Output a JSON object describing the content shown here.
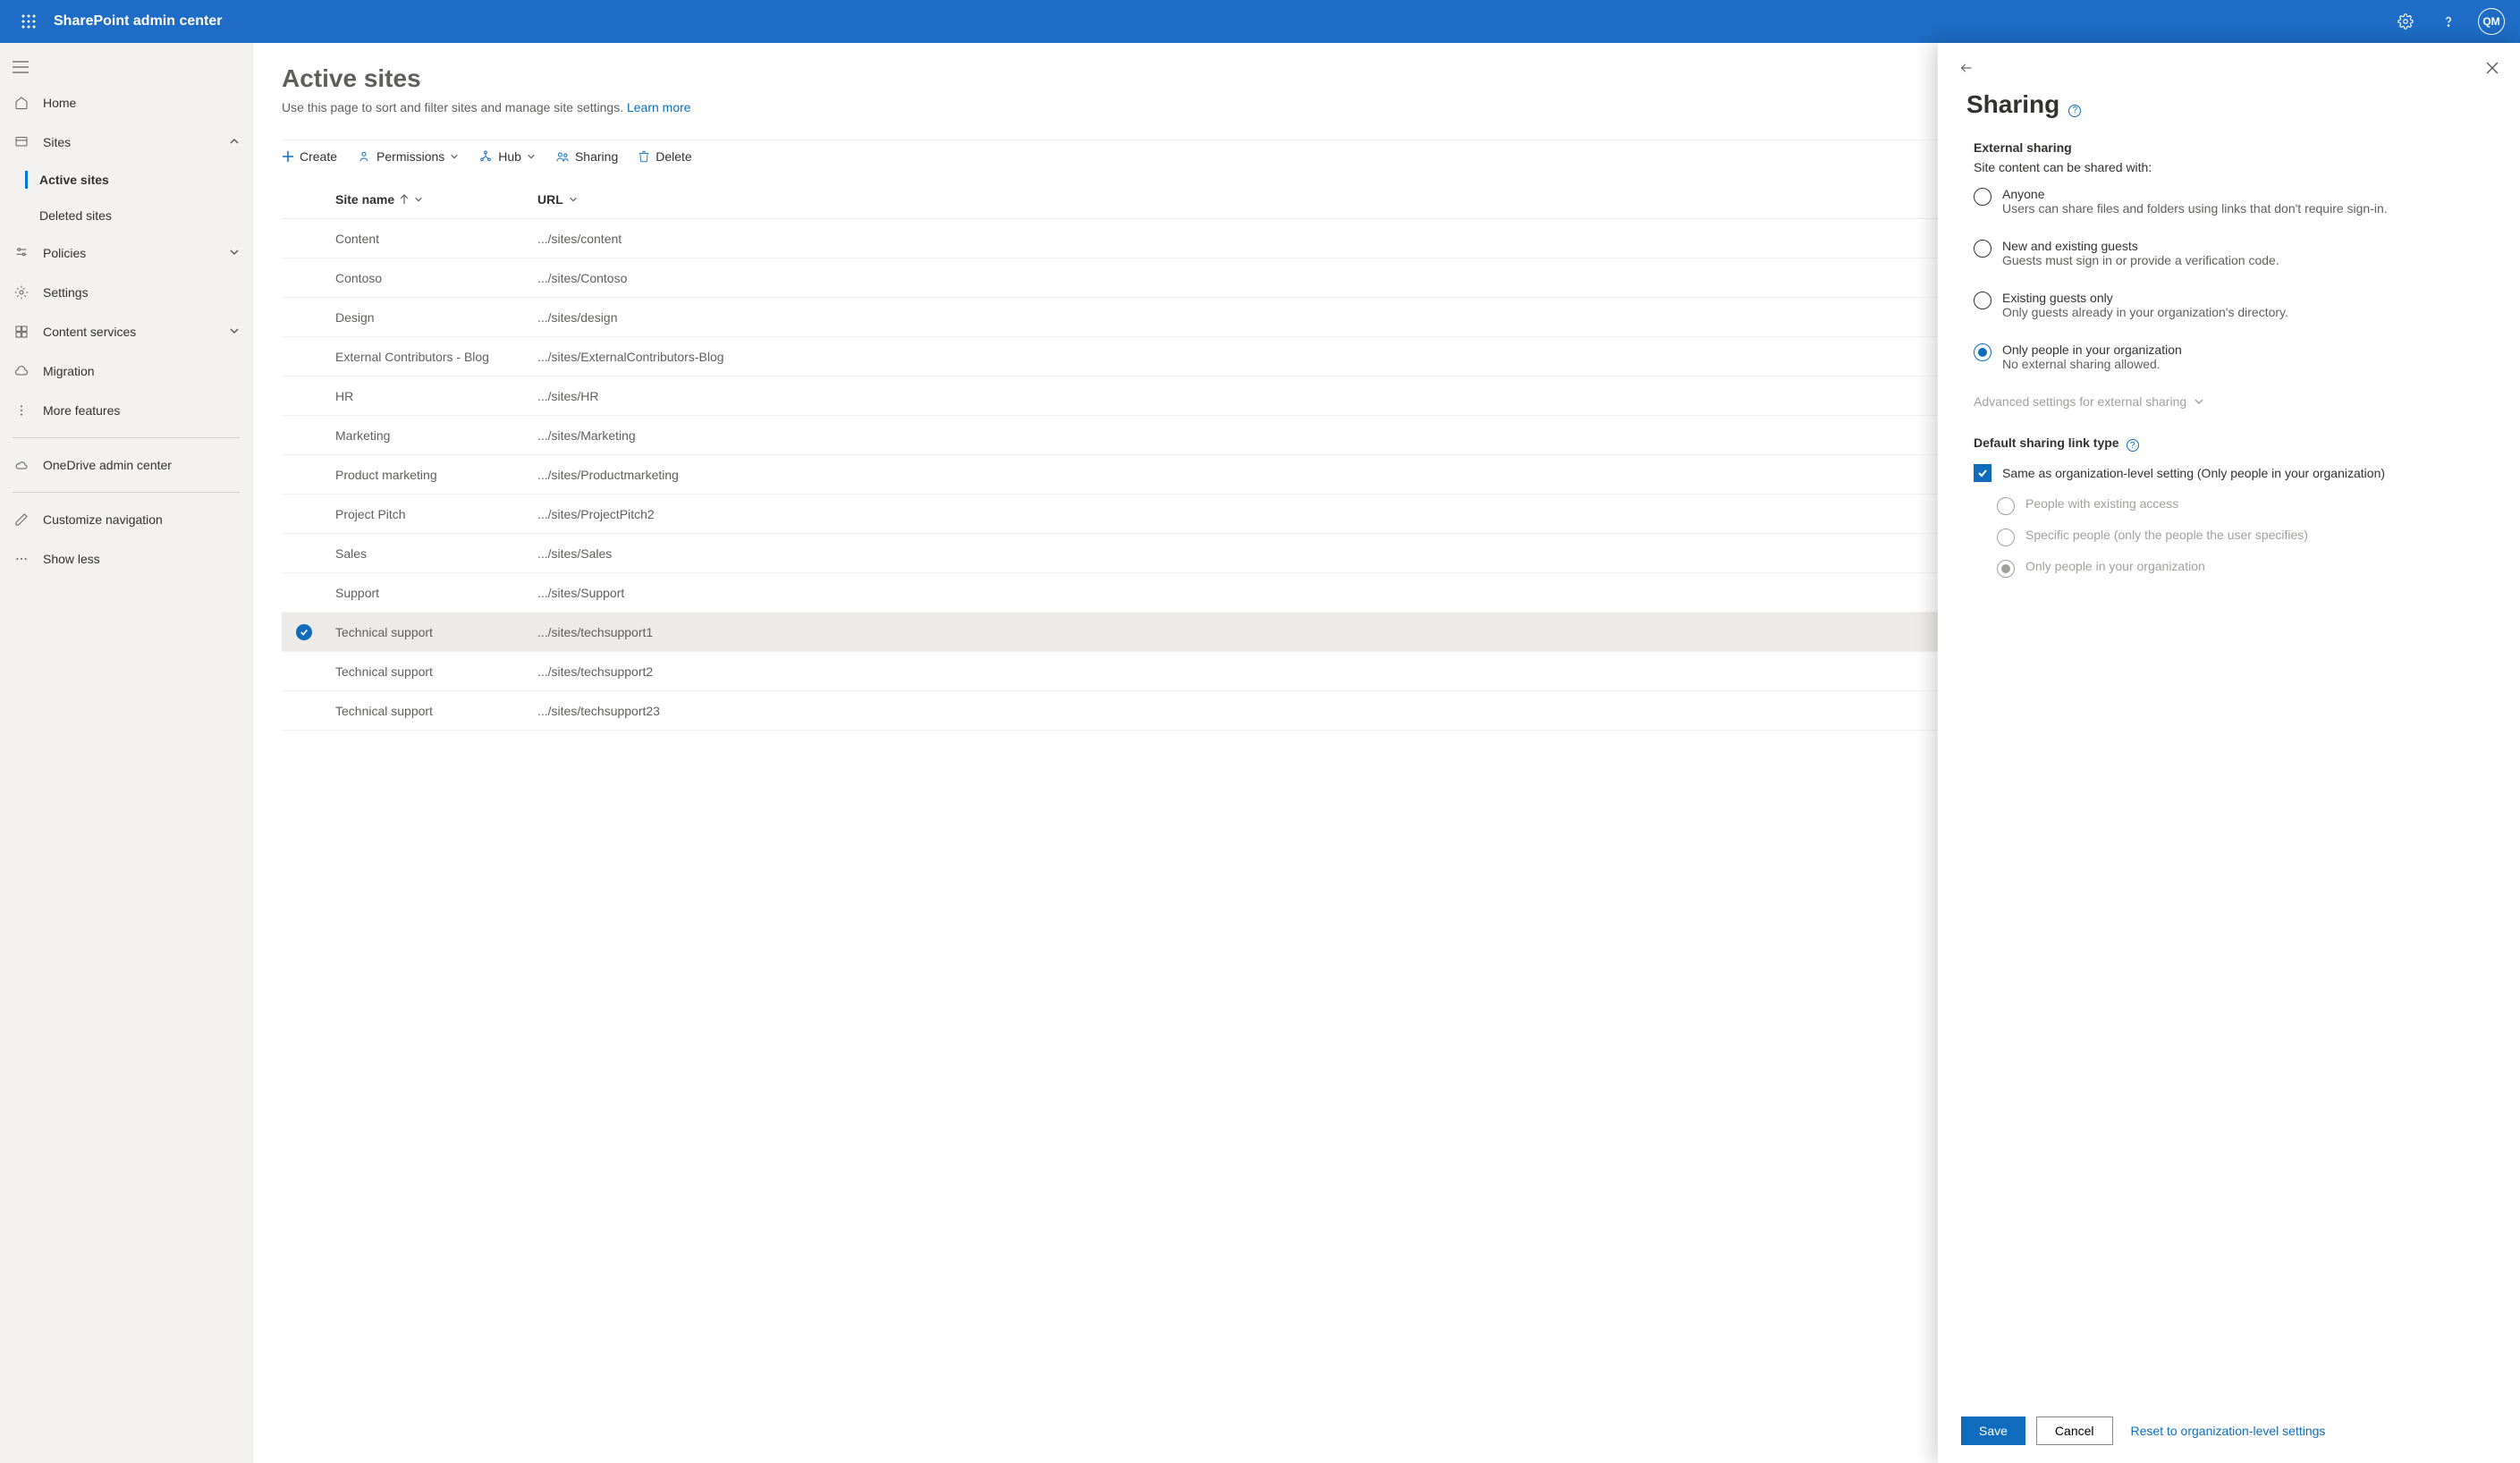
{
  "header": {
    "title": "SharePoint admin center",
    "avatar": "QM"
  },
  "sidebar": {
    "home": "Home",
    "sites": "Sites",
    "active_sites": "Active sites",
    "deleted_sites": "Deleted sites",
    "policies": "Policies",
    "settings": "Settings",
    "content_services": "Content services",
    "migration": "Migration",
    "more_features": "More features",
    "onedrive": "OneDrive admin center",
    "customize": "Customize navigation",
    "show_less": "Show less"
  },
  "page": {
    "title": "Active sites",
    "desc": "Use this page to sort and filter sites and manage site settings. ",
    "learn": "Learn more"
  },
  "cmdbar": {
    "create": "Create",
    "permissions": "Permissions",
    "hub": "Hub",
    "sharing": "Sharing",
    "delete": "Delete"
  },
  "table": {
    "col_name": "Site name",
    "col_url": "URL",
    "rows": [
      {
        "name": "Content",
        "url": ".../sites/content"
      },
      {
        "name": "Contoso",
        "url": ".../sites/Contoso"
      },
      {
        "name": "Design",
        "url": ".../sites/design"
      },
      {
        "name": "External Contributors - Blog",
        "url": ".../sites/ExternalContributors-Blog"
      },
      {
        "name": "HR",
        "url": ".../sites/HR"
      },
      {
        "name": "Marketing",
        "url": ".../sites/Marketing"
      },
      {
        "name": "Product marketing",
        "url": ".../sites/Productmarketing"
      },
      {
        "name": "Project Pitch",
        "url": ".../sites/ProjectPitch2"
      },
      {
        "name": "Sales",
        "url": ".../sites/Sales"
      },
      {
        "name": "Support",
        "url": ".../sites/Support"
      },
      {
        "name": "Technical support",
        "url": ".../sites/techsupport1",
        "selected": true
      },
      {
        "name": "Technical support",
        "url": ".../sites/techsupport2"
      },
      {
        "name": "Technical support",
        "url": ".../sites/techsupport23"
      }
    ]
  },
  "panel": {
    "title": "Sharing",
    "ext_title": "External sharing",
    "ext_desc": "Site content can be shared with:",
    "opts": [
      {
        "label": "Anyone",
        "sub": "Users can share files and folders using links that don't require sign-in."
      },
      {
        "label": "New and existing guests",
        "sub": "Guests must sign in or provide a verification code."
      },
      {
        "label": "Existing guests only",
        "sub": "Only guests already in your organization's directory."
      },
      {
        "label": "Only people in your organization",
        "sub": "No external sharing allowed.",
        "checked": true
      }
    ],
    "advanced": "Advanced settings for external sharing",
    "link_title": "Default sharing link type",
    "same_label": "Same as organization-level setting (Only people in your organization)",
    "link_opts": [
      "People with existing access",
      "Specific people (only the people the user specifies)",
      "Only people in your organization"
    ],
    "save": "Save",
    "cancel": "Cancel",
    "reset": "Reset to organization-level settings"
  }
}
